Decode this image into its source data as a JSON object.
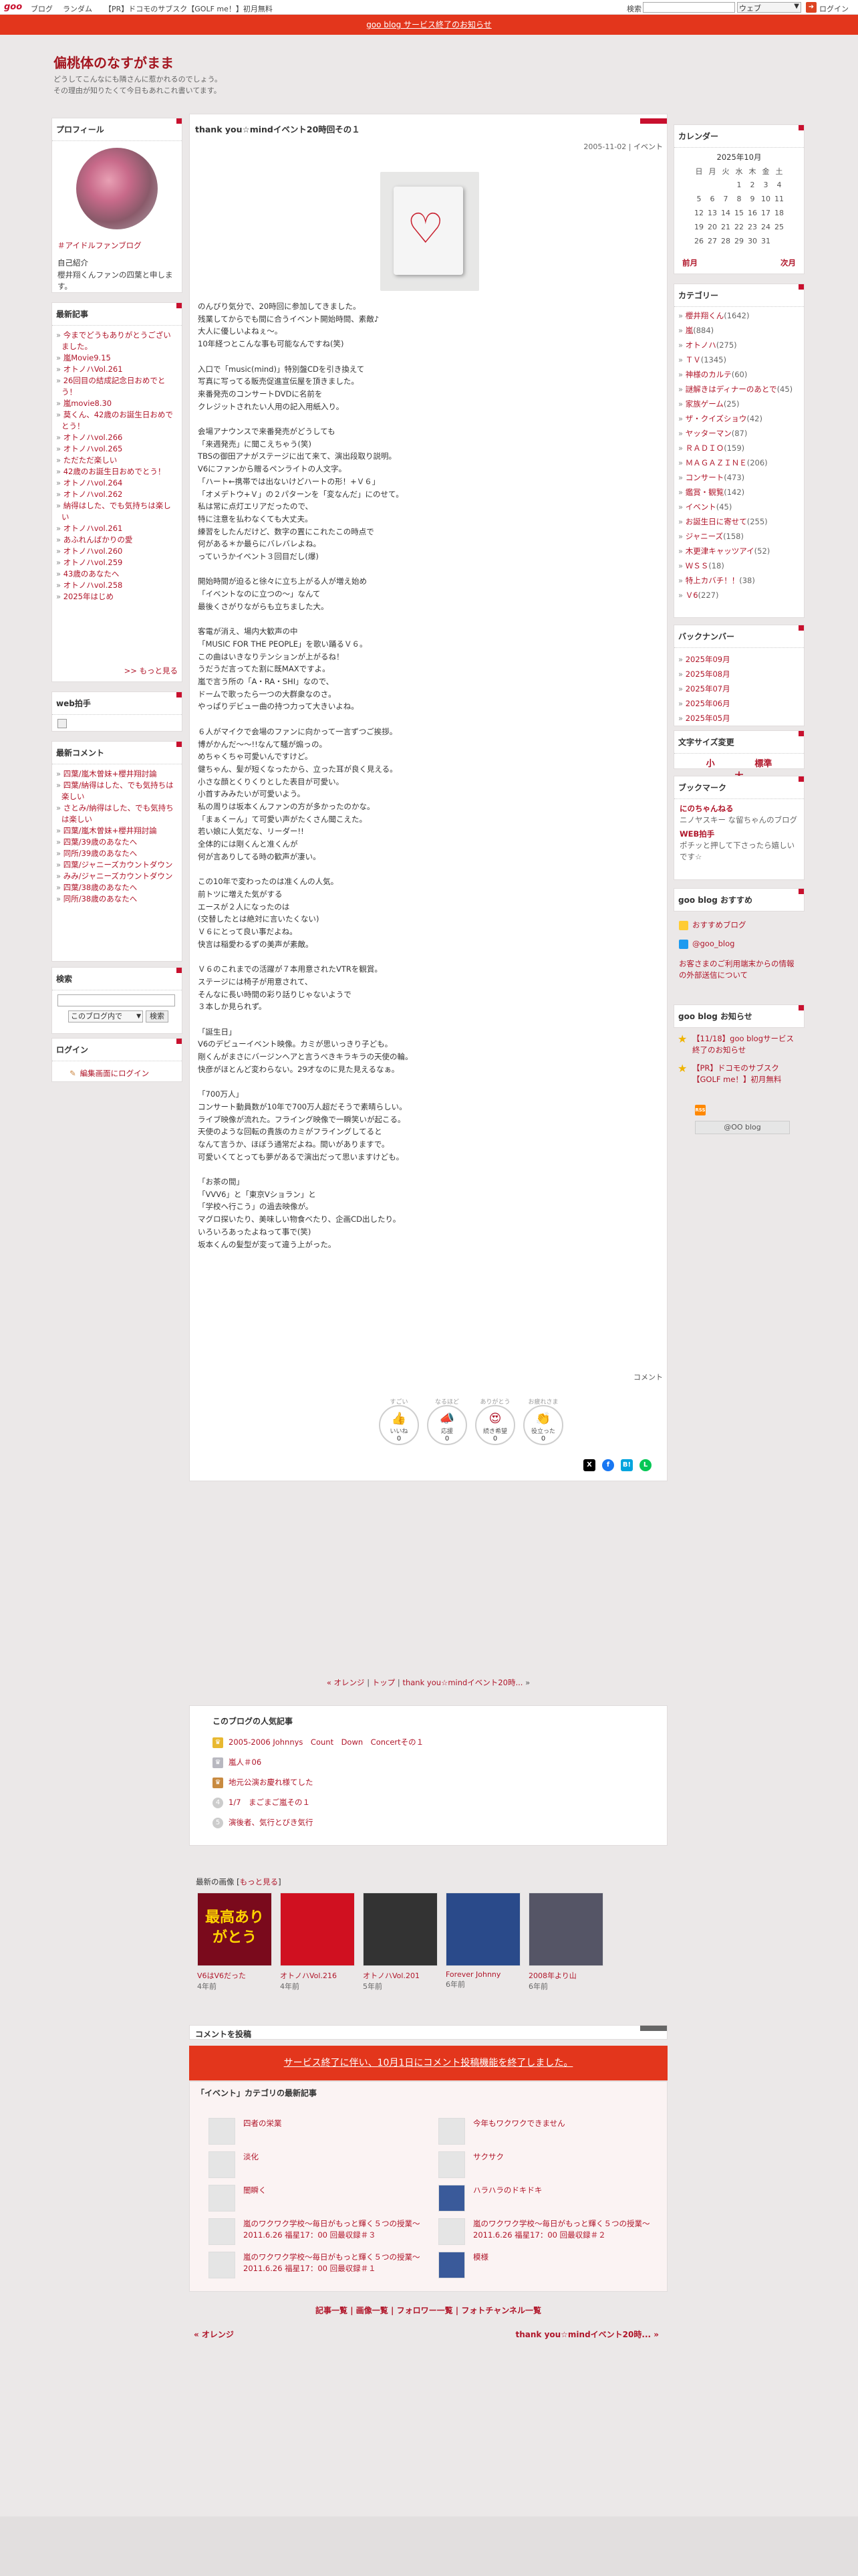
{
  "topbar": {
    "logo": "goo",
    "links": [
      "ブログ",
      "ランダム",
      "【PR】ドコモのサブスク【GOLF me！】初月無料"
    ],
    "search_label": "検索",
    "search_value": "",
    "search_select": "ウェブ",
    "login": "ログイン"
  },
  "notice": "goo blog サービス終了のお知らせ",
  "blog": {
    "title": "偏桃体のなすがまま",
    "desc1": "どうしてこんなにも隣さんに惹かれるのでしょう。",
    "desc2": "その理由が知りたくて今日もあれこれ書いてます。"
  },
  "profile": {
    "head": "プロフィール",
    "name": "＃アイドルファンブログ",
    "intro_head": "自己紹介",
    "intro": "櫻井翔くんファンの四葉と申します。"
  },
  "recent_posts": {
    "head": "最新記事",
    "items": [
      "今までどうもありがとうございました。",
      "嵐Movie9.15",
      "オトノハVol.261",
      "26回目の結成記念日おめでとう！",
      "嵐movie8.30",
      "莫くん、42歳のお誕生日おめでとう！",
      "オトノハvol.266",
      "オトノハvol.265",
      "ただただ楽しい",
      "42歳のお誕生日おめでとう！",
      "オトノハvol.264",
      "オトノハvol.262",
      "納得はした、でも気持ちは楽しい",
      "オトノハvol.261",
      "あふれんばかりの愛",
      "オトノハvol.260",
      "オトノハvol.259",
      "43歳のあなたへ",
      "オトノハvol.258",
      "2025年はじめ"
    ],
    "more": ">> もっと見る"
  },
  "web_clap": {
    "head": "web拍手"
  },
  "recent_comments": {
    "head": "最新コメント",
    "items": [
      "四葉/嵐木曽妹+櫻井翔討論",
      "四葉/納得はした、でも気持ちは楽しい",
      "さとみ/納得はした、でも気持ちは楽しい",
      "四葉/嵐木曽妹+櫻井翔討論",
      "四葉/39歳のあなたへ",
      "同所/39歳のあなたへ",
      "四葉/ジャニーズカウントダウン",
      "みみ/ジャニーズカウントダウン",
      "四葉/38歳のあなたへ",
      "同所/38歳のあなたへ"
    ]
  },
  "search_box": {
    "head": "検索",
    "select": "このブログ内で",
    "button": "検索"
  },
  "login_box": {
    "head": "ログイン",
    "link": "編集画面にログイン"
  },
  "calendar": {
    "head": "カレンダー",
    "month": "2025年10月",
    "weekdays": [
      "日",
      "月",
      "火",
      "水",
      "木",
      "金",
      "土"
    ],
    "weeks": [
      [
        "",
        "",
        "",
        "1",
        "2",
        "3",
        "4"
      ],
      [
        "5",
        "6",
        "7",
        "8",
        "9",
        "10",
        "11"
      ],
      [
        "12",
        "13",
        "14",
        "15",
        "16",
        "17",
        "18"
      ],
      [
        "19",
        "20",
        "21",
        "22",
        "23",
        "24",
        "25"
      ],
      [
        "26",
        "27",
        "28",
        "29",
        "30",
        "31",
        ""
      ]
    ],
    "prev": "前月",
    "next": "次月"
  },
  "categories": {
    "head": "カテゴリー",
    "items": [
      [
        "櫻井翔くん",
        "(1642)"
      ],
      [
        "嵐",
        "(884)"
      ],
      [
        "オトノハ",
        "(275)"
      ],
      [
        "ＴＶ",
        "(1345)"
      ],
      [
        "神様のカルテ",
        "(60)"
      ],
      [
        "謎解きはディナーのあとで",
        "(45)"
      ],
      [
        "家族ゲーム",
        "(25)"
      ],
      [
        "ザ・クイズショウ",
        "(42)"
      ],
      [
        "ヤッターマン",
        "(87)"
      ],
      [
        "ＲＡＤＩＯ",
        "(159)"
      ],
      [
        "ＭＡＧＡＺＩＮＥ",
        "(206)"
      ],
      [
        "コンサート",
        "(473)"
      ],
      [
        "鑑賞・観覧",
        "(142)"
      ],
      [
        "イベント",
        "(45)"
      ],
      [
        "お誕生日に寄せて",
        "(255)"
      ],
      [
        "ジャニーズ",
        "(158)"
      ],
      [
        "木更津キャッツアイ",
        "(52)"
      ],
      [
        "ＷＳＳ",
        "(18)"
      ],
      [
        "特上カバチ！！",
        "(38)"
      ],
      [
        "Ｖ6",
        "(227)"
      ]
    ]
  },
  "backnumber": {
    "head": "バックナンバー",
    "items": [
      "2025年09月",
      "2025年08月",
      "2025年07月",
      "2025年06月",
      "2025年05月"
    ]
  },
  "font_size": {
    "head": "文字サイズ変更",
    "small": "小",
    "normal": "標準",
    "large": "大"
  },
  "bookmark": {
    "head": "ブックマーク",
    "b1_title": "にのちゃんねる",
    "b1_desc": "ニノヤスキー な留ちゃんのブログ",
    "b2_title": "WEB拍手",
    "b2_desc": "ポチッと押して下さったら嬉しいです☆"
  },
  "goo_recommend": {
    "head": "goo blog おすすめ",
    "item1": "おすすめブログ",
    "item2": "@goo_blog",
    "note": "お客さまのご利用端末からの情報の外部送信について"
  },
  "goo_news": {
    "head": "goo blog お知らせ",
    "item1": "【11/18】goo blogサービス終了のお知らせ",
    "item2": "【PR】ドコモのサブスク【GOLF me！】初月無料"
  },
  "rss": "RSS",
  "goo_badge": "@OO blog",
  "post": {
    "title": "thank you☆mindイベント20時回その１",
    "date": "2005-11-02",
    "category": "イベント",
    "paragraphs": [
      "のんびり気分で、20時回に参加してきました。\n残業してからでも間に合うイベント開始時間、素敵♪\n大人に優しいよねぇ〜。\n10年経つとこんな事も可能なんですね(笑)",
      "入口で「music(mind)」特別盤CDを引き換えて\n写真に写ってる販売促進宣伝屋を頂きました。\n来番発売のコンサートDVDに名前を\nクレジットされたい人用の記入用紙入り。",
      "会場アナウンスで来番発売がどうしても\n「来週発売」に聞こえちゃう(笑)\nTBSの御田アナがステージに出て来て、演出段取り説明。\nV6にファンから贈るペンライトの人文字。\n「ハート←携帯では出ないけどハートの形！+Ｖ６」\n「オメデトウ+Ｖ」の２パターンを「変なんだ」にのせて。\n私は常に点灯エリアだったので、\n特に注意を払わなくても大丈夫。\n練習をしたんだけど、数字の置にこれたこの時点で\n何がある＊か最らにバレバレよね。\nっていうかイベント３回目だし(爆)",
      "開始時間が迫ると徐々に立ち上がる人が増え始め\n「イベントなのに立つの〜」なんて\n最後くさがりながらも立ちました大。",
      "客電が消え、場内大歓声の中\n「MUSIC FOR THE PEOPLE」を歌い踊るＶ６。\nこの曲はいきなりテンションが上がるね！\nうだうだ言ってた割に既MAXですよ。\n嵐で言う所の「A・RA・SHI」なので、\nドームで歌ったら一つの大群衆なのさ。\nやっぱりデビュー曲の持つ力って大きいよね。",
      "６人がマイクで会場のファンに向かって一言ずつご挨拶。\n博がかんだ〜〜!!なんて騒が煽っの。\nめちゃくちゃ可愛いんですけど。\n健ちゃん、髪が短くなったから、立った耳が良く見える。\n小さな顔とくりくりとした表目が可愛い。\n小首すみみたいが可愛いよう。\n私の周りは坂本くんファンの方が多かったのかな。\n「まぁくーん」て可愛い声がたくさん聞こえた。\n若い娘に人気だな、リーダー!!\n全体的には剛くんと准くんが\n何が言ありしてる時の歓声が凄い。",
      "この10年で変わったのは准くんの人気。\n前トツに増えた気がする\nエースが２人になったのは\n(交替したとは絶対に言いたくない)\nＶ６にとって良い事だよね。\n快言は稲愛わるずの美声が素敵。",
      "Ｖ６のこれまでの活躍が７本用意されたVTRを観賞。\nステージには椅子が用意されて、\nそんなに長い時間の彩り話りじゃないようで\n３本しか見られず。",
      "「誕生日」\nV6のデビューイベント映像。カミが思いっきり子ども。\n剛くんがまさにバージンヘアと言うべきキラキラの天使の輪。\n快彦がほとんど変わらない。29才なのに見た見えるなぁ。",
      "「700万人」\nコンサート動員数が10年で700万人超だそうで素晴らしい。\nライブ映像が流れた。フライング映像で一瞬笑いが起こる。\n天使のような回転の貴族のカミがフライングしてると\nなんて言うか、ほぼう通常だよね。間いがありますで。\n可愛いくてとっても夢があるで演出だって思いますけども。",
      "「お茶の間」\n「VVV6」と「東京Vショラン」と\n「学校へ行こう」の過去映像が。\nマグロ探いたり、美味しい物食べたり、企画CD出したり。\nいろいろあったよねって事で(笑)\n坂本くんの髪型が変って違う上がった。"
    ],
    "comment_link": "コメント"
  },
  "reactions": [
    {
      "label": "すごい",
      "name": "いいね",
      "count": "0",
      "sym": "👍"
    },
    {
      "label": "なるほど",
      "name": "応援",
      "count": "0",
      "sym": "📣"
    },
    {
      "label": "ありがとう",
      "name": "続き希望",
      "count": "0",
      "sym": "😍"
    },
    {
      "label": "お疲れさま",
      "name": "役立った",
      "count": "0",
      "sym": "👏"
    }
  ],
  "share": {
    "x": "X",
    "fb": "f",
    "hb": "B!",
    "line": "L"
  },
  "postnav": {
    "prev": "« オレンジ",
    "top": "トップ",
    "next": "thank you☆mindイベント20時...",
    "end": "»",
    "sep": "|"
  },
  "popular": {
    "head": "このブログの人気記事",
    "items": [
      "2005-2006 Johnnys　Count　Down　Concertその１",
      "嵐人＃06",
      "地元公演お慶れ様てした",
      "1/7　まごまご嵐その１",
      "演後者、気行とびき気行"
    ]
  },
  "recent_images": {
    "head": "最新の画像",
    "more": "もっと見る",
    "items": [
      {
        "caption": "V6はV6だった",
        "age": "4年前",
        "text": "最高ありがとう"
      },
      {
        "caption": "オトノハVol.216",
        "age": "4年前",
        "text": ""
      },
      {
        "caption": "オトノハVol.201",
        "age": "5年前",
        "text": ""
      },
      {
        "caption": "Forever Johnny",
        "age": "6年前",
        "text": ""
      },
      {
        "caption": "2008年より山",
        "age": "6年前",
        "text": ""
      }
    ]
  },
  "comment_form": {
    "head": "コメントを投稿",
    "closed": "サービス終了に伴い、10月1日にコメント投稿機能を終了しました。"
  },
  "category_latest": {
    "head": "「イベント」カテゴリの最新記事",
    "items": [
      "四者の栄業",
      "今年もワクワクできません",
      "淡化",
      "サクサク",
      "闇瞬く",
      "ハラハラのドキドキ",
      "嵐のワクワク学校〜毎日がもっと輝く５つの授業〜2011.6.26 福星17：00 回最収録＃３",
      "嵐のワクワク学校〜毎日がもっと輝く５つの授業〜2011.6.26 福星17：00 回最収録＃２",
      "嵐のワクワク学校〜毎日がもっと輝く５つの授業〜2011.6.26 福星17：00 回最収録＃１",
      "模様"
    ]
  },
  "footer_nav": {
    "a": "記事一覧",
    "b": "画像一覧",
    "c": "フォロワー一覧",
    "d": "フォトチャンネル一覧",
    "sep": "|"
  },
  "footer_prev": "« オレンジ",
  "footer_next": "thank you☆mindイベント20時... »",
  "colors": {
    "accent": "#c8102e",
    "notice": "#e3361c",
    "link": "#b0162a"
  }
}
